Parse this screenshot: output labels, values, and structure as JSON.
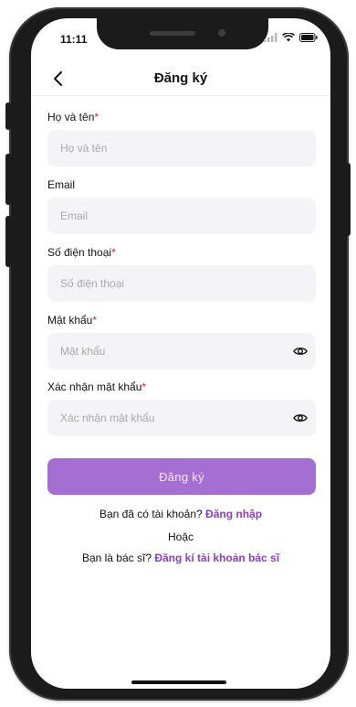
{
  "status": {
    "time": "11:11"
  },
  "header": {
    "title": "Đăng ký"
  },
  "form": {
    "full_name": {
      "label": "Họ và tên",
      "required_mark": "*",
      "placeholder": "Họ và tên"
    },
    "email": {
      "label": "Email",
      "placeholder": "Email"
    },
    "phone": {
      "label": "Số điện thoại",
      "required_mark": "*",
      "placeholder": "Số điện thoại"
    },
    "password": {
      "label": "Mật khẩu",
      "required_mark": "*",
      "placeholder": "Mật khẩu"
    },
    "confirm_password": {
      "label": "Xác nhận mật khẩu",
      "required_mark": "*",
      "placeholder": "Xác nhận mật khẩu"
    },
    "submit_label": "Đăng ký"
  },
  "footer": {
    "have_account_text": "Bạn đã có tài khoản?",
    "login_link": "Đăng nhập",
    "or_text": "Hoặc",
    "doctor_text": "Bạn là bác sĩ?",
    "doctor_link": "Đăng kí tài khoản bác sĩ"
  },
  "colors": {
    "accent": "#a46ed3",
    "link": "#8a3fc2",
    "required": "#d81b3a",
    "field_bg": "#f4f4f6"
  },
  "icons": [
    "back-chevron-icon",
    "eye-icon",
    "signal-icon",
    "wifi-icon",
    "battery-icon"
  ]
}
